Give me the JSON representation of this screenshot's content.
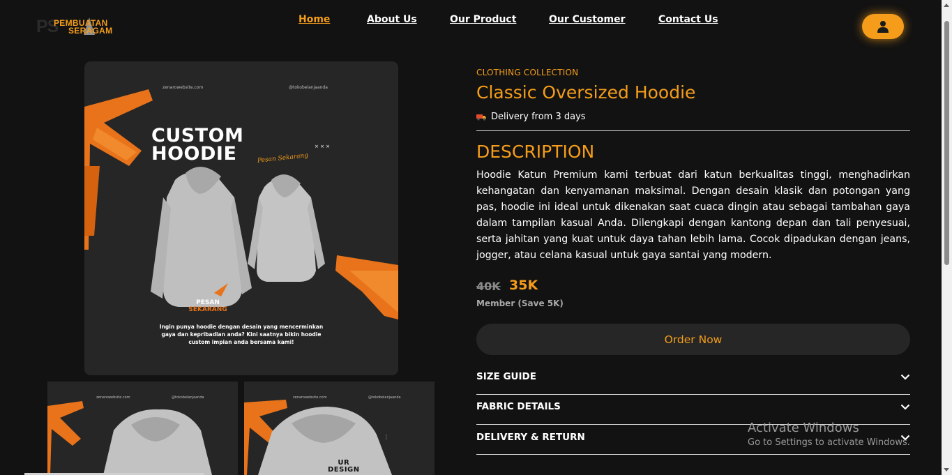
{
  "logo": {
    "ps": "PS",
    "line1": "PEMBUATAN",
    "line2": "SERAGAM"
  },
  "nav": {
    "items": [
      "Home",
      "About Us",
      "Our Product",
      "Our Customer",
      "Contact Us"
    ],
    "active": "Home"
  },
  "user_button": {
    "icon": "user-icon"
  },
  "main_image": {
    "site": "zenarowebsite.com",
    "handle": "@tokobelanjaanda",
    "title_line1": "CUSTOM",
    "title_line2": "HOODIE",
    "script": "Pesan Sekarang",
    "cta_line1": "PESAN",
    "cta_line2": "SEKARANG",
    "promo": "Ingin punya hoodie dengan desain yang mencerminkan gaya dan kepribadian anda? Kini saatnya bikin hoodie custom impian anda bersama kami!"
  },
  "thumbnails": [
    {
      "site": "zenarowebsite.com",
      "handle": "@tokobelanjaanda"
    },
    {
      "site": "zenarowebsite.com",
      "handle": "@tokobelanjaanda",
      "print_line1": "UR",
      "print_line2": "DESIGN"
    }
  ],
  "product": {
    "category": "CLOTHING COLLECTION",
    "title": "Classic Oversized Hoodie",
    "delivery": "Delivery from 3 days",
    "delivery_icon": "truck-icon",
    "description_heading": "DESCRIPTION",
    "description": "Hoodie Katun Premium kami terbuat dari katun berkualitas tinggi, menghadirkan kehangatan dan kenyamanan maksimal. Dengan desain klasik dan potongan yang pas, hoodie ini ideal untuk dikenakan saat cuaca dingin atau sebagai tambahan gaya dalam tampilan kasual Anda. Dilengkapi dengan kantong depan dan tali penyesuai, serta jahitan yang kuat untuk daya tahan lebih lama. Cocok dipadukan dengan jeans, jogger, atau celana kasual untuk gaya santai yang modern.",
    "old_price": "40K",
    "new_price": "35K",
    "member_note": "Member (Save 5K)",
    "order_button": "Order Now"
  },
  "accordions": [
    "SIZE GUIDE",
    "FABRIC DETAILS",
    "DELIVERY & RETURN"
  ],
  "watermark": {
    "line1": "Activate Windows",
    "line2": "Go to Settings to activate Windows."
  },
  "colors": {
    "accent": "#f59d1a",
    "background": "#121212",
    "panel": "#262626"
  }
}
